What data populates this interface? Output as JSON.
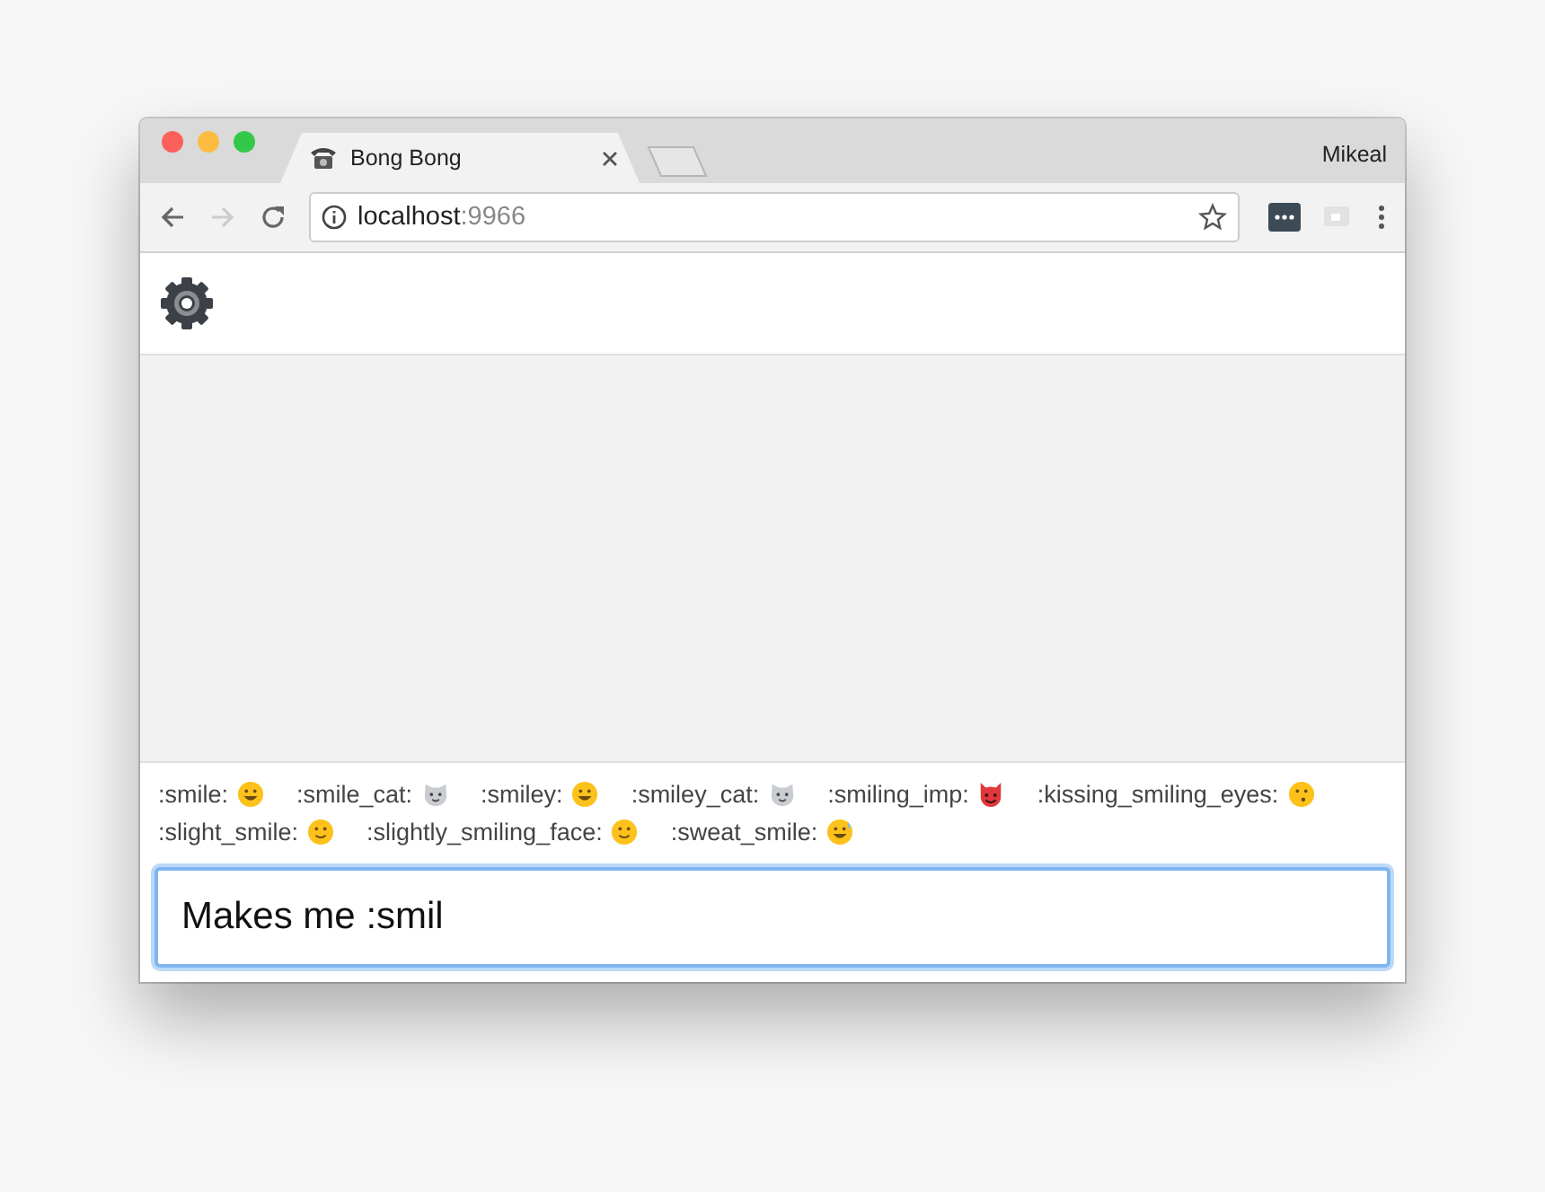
{
  "window": {
    "user": "Mikeal"
  },
  "tabs": [
    {
      "title": "Bong Bong",
      "selected": true
    }
  ],
  "address_bar": {
    "host": "localhost",
    "port": ":9966"
  },
  "suggestions": [
    {
      "label": ":smile:",
      "kind": "grin"
    },
    {
      "label": ":smile_cat:",
      "kind": "cat"
    },
    {
      "label": ":smiley:",
      "kind": "grin"
    },
    {
      "label": ":smiley_cat:",
      "kind": "cat"
    },
    {
      "label": ":smiling_imp:",
      "kind": "imp"
    },
    {
      "label": ":kissing_smiling_eyes:",
      "kind": "kiss"
    },
    {
      "label": ":slight_smile:",
      "kind": "smile"
    },
    {
      "label": ":slightly_smiling_face:",
      "kind": "smile"
    },
    {
      "label": ":sweat_smile:",
      "kind": "sweat"
    }
  ],
  "message_input": {
    "value": "Makes me :smil",
    "focused": true
  }
}
